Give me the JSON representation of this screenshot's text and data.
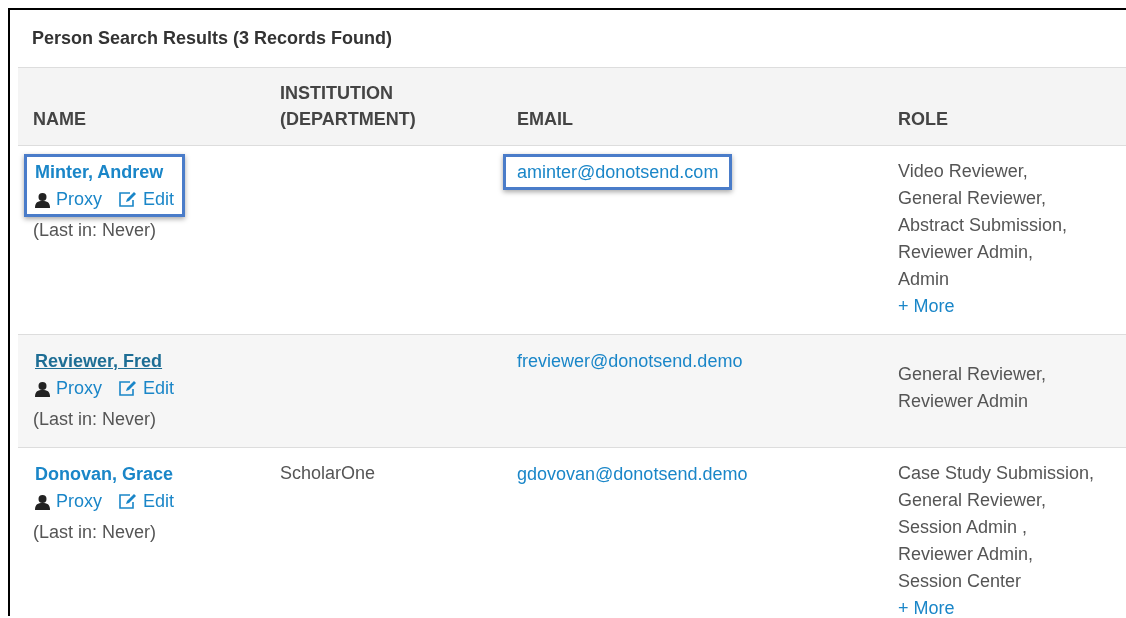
{
  "panel": {
    "title": "Person Search Results (3 Records Found)"
  },
  "table": {
    "columns": [
      {
        "label": "NAME"
      },
      {
        "label": "INSTITUTION (DEPARTMENT)"
      },
      {
        "label": "EMAIL"
      },
      {
        "label": "ROLE"
      }
    ],
    "rows": [
      {
        "name": "Minter, Andrew",
        "proxy": "Proxy",
        "edit": "Edit",
        "last_in": "(Last in: Never)",
        "institution": "",
        "email": "aminter@donotsend.com",
        "roles": [
          "Video Reviewer,",
          "General Reviewer,",
          "Abstract Submission,",
          "Reviewer Admin,",
          "Admin"
        ],
        "more": "+ More",
        "highlighted": true,
        "hovered": false
      },
      {
        "name": "Reviewer, Fred",
        "proxy": "Proxy",
        "edit": "Edit",
        "last_in": "(Last in: Never)",
        "email": "freviewer@donotsend.demo",
        "roles": [
          "General Reviewer,",
          "Reviewer Admin"
        ],
        "highlighted": false,
        "hovered": true
      },
      {
        "name": "Donovan, Grace",
        "proxy": "Proxy",
        "edit": "Edit",
        "last_in": "(Last in: Never)",
        "institution": "ScholarOne",
        "email": "gdovovan@donotsend.demo",
        "roles": [
          "Case Study Submission,",
          "General Reviewer,",
          "Session Admin ,",
          "Reviewer Admin,",
          "Session Center"
        ],
        "more": "+ More",
        "highlighted": false,
        "hovered": false
      }
    ]
  }
}
